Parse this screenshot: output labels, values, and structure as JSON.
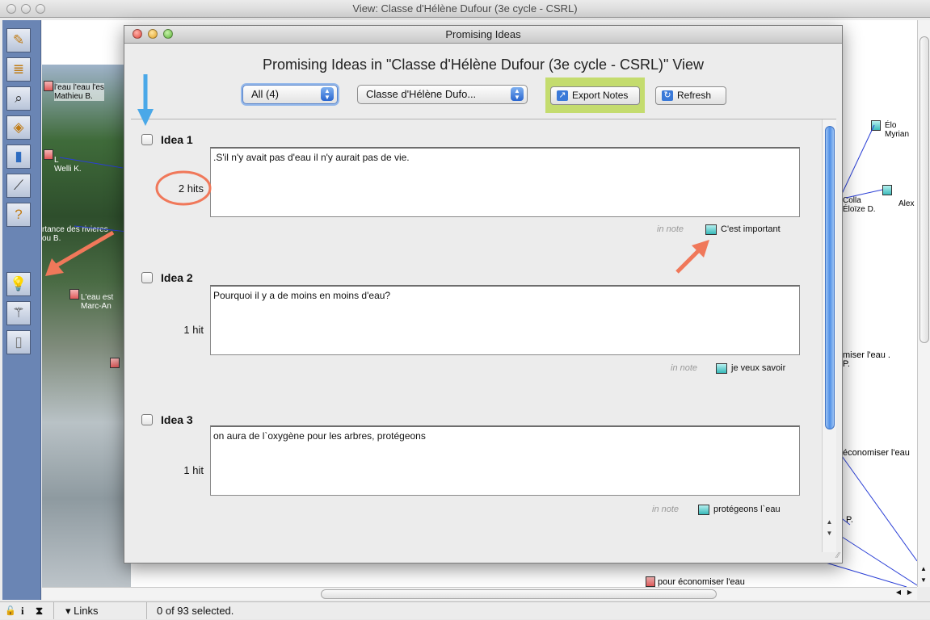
{
  "outer_window": {
    "title": "View: Classe d'Hélène Dufour (3e cycle - CSRL)"
  },
  "toolbar": {
    "icons": [
      "pencil-icon",
      "scaffold-icon",
      "search-icon",
      "notebook-icon",
      "chart-icon",
      "brush-icon",
      "help-icon",
      "lightbulb-icon",
      "magic-wand-icon",
      "door-icon"
    ]
  },
  "canvas": {
    "notes": [
      {
        "text": "l'eau l'eau l'es",
        "author": "Mathieu B."
      },
      {
        "text": "L",
        "author": "Welli K."
      },
      {
        "text": "rtance des rivieres",
        "author": "ou B."
      },
      {
        "text": "L'eau est",
        "author": "Marc-An"
      },
      {
        "text": "Élo",
        "author": "Myrian"
      },
      {
        "text": "Colla",
        "author": "Éloïze D."
      },
      {
        "text": "Alex",
        "author": ""
      },
      {
        "text": "miser l'eau .",
        "author": "P."
      },
      {
        "text": "économiser l'eau",
        "author": ""
      },
      {
        "text": "P.",
        "author": ""
      },
      {
        "text": "pour économiser l'eau",
        "author": ""
      }
    ]
  },
  "status": {
    "lock": "🔓",
    "info": "i",
    "links_label": "▾ Links",
    "selection": "0 of 93 selected."
  },
  "dialog": {
    "title": "Promising Ideas",
    "heading": "Promising Ideas in \"Classe d'Hélène Dufour (3e cycle - CSRL)\" View",
    "filter_select": "All (4)",
    "view_select": "Classe d'Hélène Dufo...",
    "export_label": "Export Notes",
    "refresh_label": "Refresh",
    "ideas": [
      {
        "title": "Idea 1",
        "hits": "2 hits",
        "text": ".S'il n'y avait pas d'eau il n'y aurait pas de vie.",
        "in_note": "in note",
        "note_title": "C'est important"
      },
      {
        "title": "Idea 2",
        "hits": "1 hit",
        "text": "Pourquoi il y a de moins en moins d'eau?",
        "in_note": "in note",
        "note_title": "je veux savoir"
      },
      {
        "title": "Idea 3",
        "hits": "1 hit",
        "text": "on aura  de  l`oxygène pour les  arbres, protégeons",
        "in_note": "in note",
        "note_title": "protégeons  l`eau"
      }
    ]
  },
  "colors": {
    "annotation_arrow_red": "#f0785a",
    "annotation_arrow_blue": "#4aa8e8",
    "highlight_green": "#c4dc6e",
    "toolbar_blue": "#6a85b4"
  }
}
